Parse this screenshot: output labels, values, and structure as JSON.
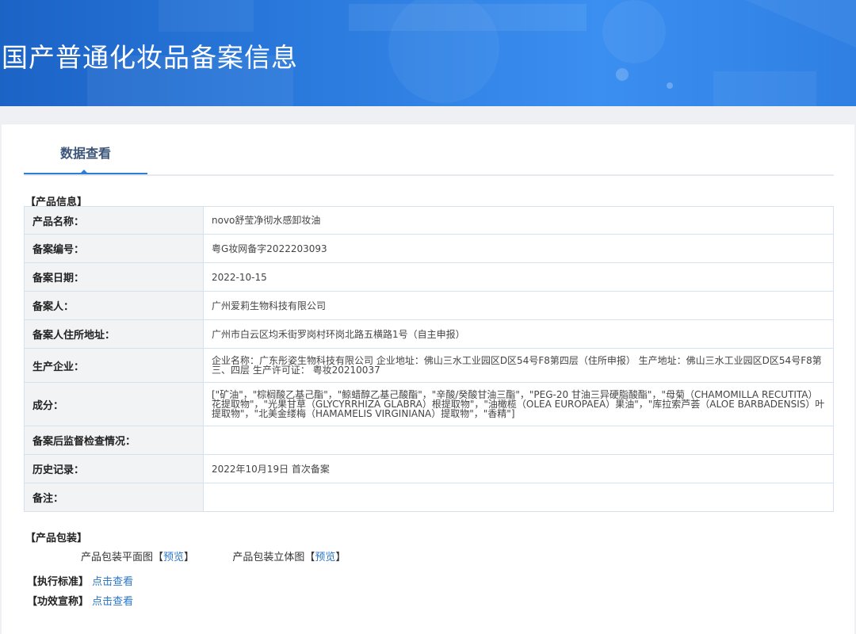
{
  "header": {
    "title": "国产普通化妆品备案信息"
  },
  "tabs": [
    {
      "label": "数据查看"
    }
  ],
  "product_info": {
    "section_label": "【产品信息】",
    "rows": [
      {
        "label": "产品名称：",
        "value": "novo舒莹净彻水感卸妆油"
      },
      {
        "label": "备案编号：",
        "value": "粤G妆网备字2022203093"
      },
      {
        "label": "备案日期：",
        "value": "2022-10-15"
      },
      {
        "label": "备案人：",
        "value": "广州爱莉生物科技有限公司"
      },
      {
        "label": "备案人住所地址：",
        "value": "广州市白云区均禾街罗岗村环岗北路五横路1号（自主申报）"
      },
      {
        "label": "生产企业：",
        "value": "企业名称：广东彤姿生物科技有限公司 企业地址：佛山三水工业园区D区54号F8第四层（住所申报） 生产地址：佛山三水工业园区D区54号F8第三、四层 生产许可证： 粤妆20210037"
      },
      {
        "label": "成分：",
        "value": "[\"矿油\"，\"棕榈酸乙基己酯\"，\"鲸蜡醇乙基己酸酯\"，\"辛酸/癸酸甘油三酯\"，\"PEG-20 甘油三异硬脂酸酯\"，\"母菊（CHAMOMILLA RECUTITA）花提取物\"，\"光果甘草（GLYCYRRHIZA GLABRA）根提取物\"，\"油橄榄（OLEA EUROPAEA）果油\"，\"库拉索芦荟（ALOE BARBADENSIS）叶提取物\"，\"北美金缕梅（HAMAMELIS VIRGINIANA）提取物\"，\"香精\"]"
      },
      {
        "label": "备案后监督检查情况：",
        "value": ""
      },
      {
        "label": "历史记录：",
        "value": "2022年10月19日 首次备案"
      },
      {
        "label": "备注：",
        "value": ""
      }
    ]
  },
  "packaging": {
    "section_label": "【产品包装】",
    "flat_label": "产品包装平面图",
    "stereo_label": "产品包装立体图",
    "bracket_open": "【",
    "bracket_close": "】",
    "preview_link": "预览"
  },
  "standard": {
    "label": "【执行标准】",
    "link": "点击查看"
  },
  "efficacy": {
    "label": "【功效宣称】",
    "link": "点击查看"
  },
  "colors": {
    "banner": "#2a79dc",
    "accent": "#2d7fd6",
    "link": "#2b76c9"
  }
}
